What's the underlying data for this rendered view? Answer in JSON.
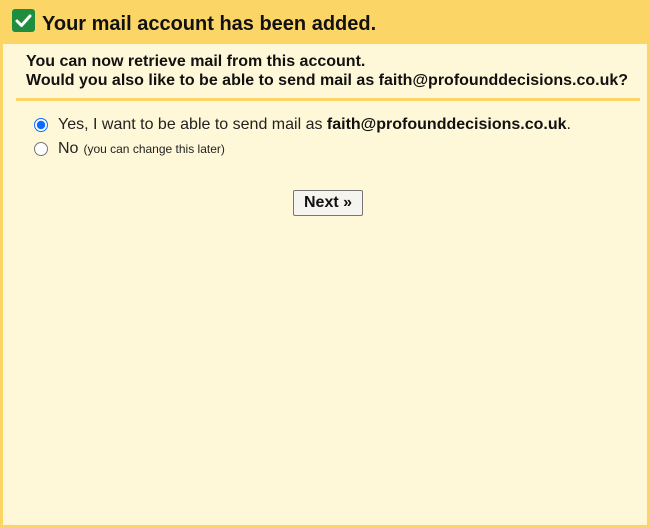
{
  "header": {
    "title": "Your mail account has been added.",
    "icon": "checkbox-checked-icon",
    "accent_color": "#fcd567",
    "check_color": "#1e8e3e"
  },
  "intro": {
    "line1": "You can now retrieve mail from this account.",
    "line2": "Would you also like to be able to send mail as faith@profounddecisions.co.uk?"
  },
  "options": {
    "yes": {
      "prefix": "Yes, I want to be able to send mail as ",
      "email": "faith@profounddecisions.co.uk",
      "suffix": ".",
      "selected": true
    },
    "no": {
      "label": "No",
      "note": "(you can change this later)",
      "selected": false
    }
  },
  "actions": {
    "next_label": "Next »"
  }
}
